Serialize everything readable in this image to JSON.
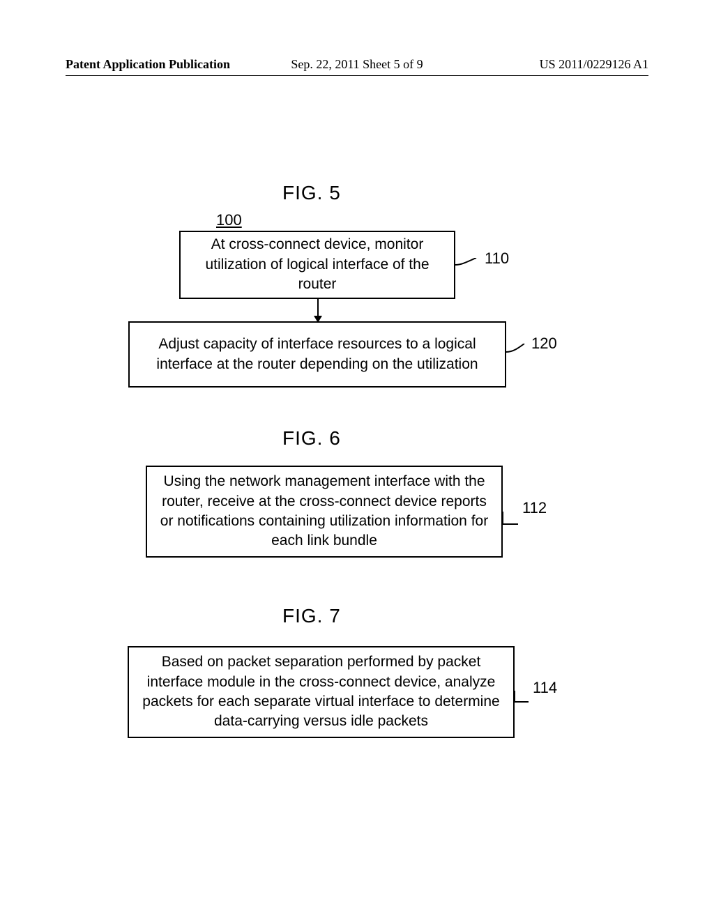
{
  "header": {
    "left": "Patent Application Publication",
    "center": "Sep. 22, 2011    Sheet 5 of 9",
    "right": "US 2011/0229126 A1"
  },
  "figure5": {
    "title": "FIG. 5",
    "ref": "100",
    "box110": {
      "text": "At cross-connect device, monitor utilization of logical interface of the router",
      "num": "110"
    },
    "box120": {
      "text": "Adjust capacity of interface resources to a logical interface at the router depending on the utilization",
      "num": "120"
    }
  },
  "figure6": {
    "title": "FIG. 6",
    "box112": {
      "text": "Using the network management interface with the router, receive at the cross-connect device reports or notifications containing utilization information for each link bundle",
      "num": "112"
    }
  },
  "figure7": {
    "title": "FIG. 7",
    "box114": {
      "text": "Based on packet separation performed by packet interface module in the cross-connect device, analyze packets for each separate virtual interface to determine data-carrying versus idle packets",
      "num": "114"
    }
  }
}
